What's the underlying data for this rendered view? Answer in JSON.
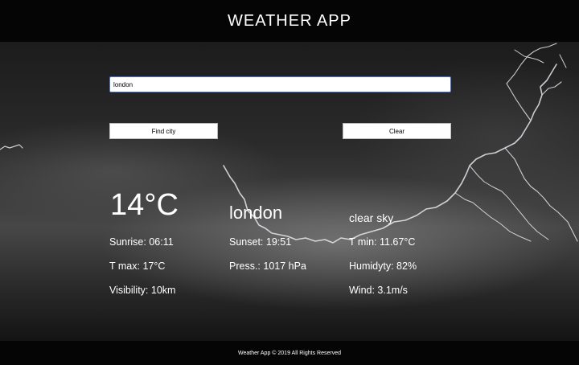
{
  "header": {
    "title": "WEATHER APP"
  },
  "search": {
    "value": "london",
    "placeholder": ""
  },
  "buttons": {
    "find_label": "Find city",
    "clear_label": "Clear"
  },
  "weather": {
    "temperature": "14°C",
    "city": "london",
    "description": "clear sky",
    "sunrise": "Sunrise: 06:11",
    "sunset": "Sunset: 19:51",
    "tmin": "T min: 11.67°C",
    "tmax": "T max: 17°C",
    "pressure": "Press.: 1017 hPa",
    "humidity": "Humidyty: 82%",
    "visibility": "Visibility: 10km",
    "wind": "Wind: 3.1m/s"
  },
  "footer": {
    "text": "Weather App © 2019 All Rights Reserved"
  },
  "colors": {
    "header_bg": "#050505",
    "text": "#ffffff",
    "input_border": "#4a6fd0"
  }
}
